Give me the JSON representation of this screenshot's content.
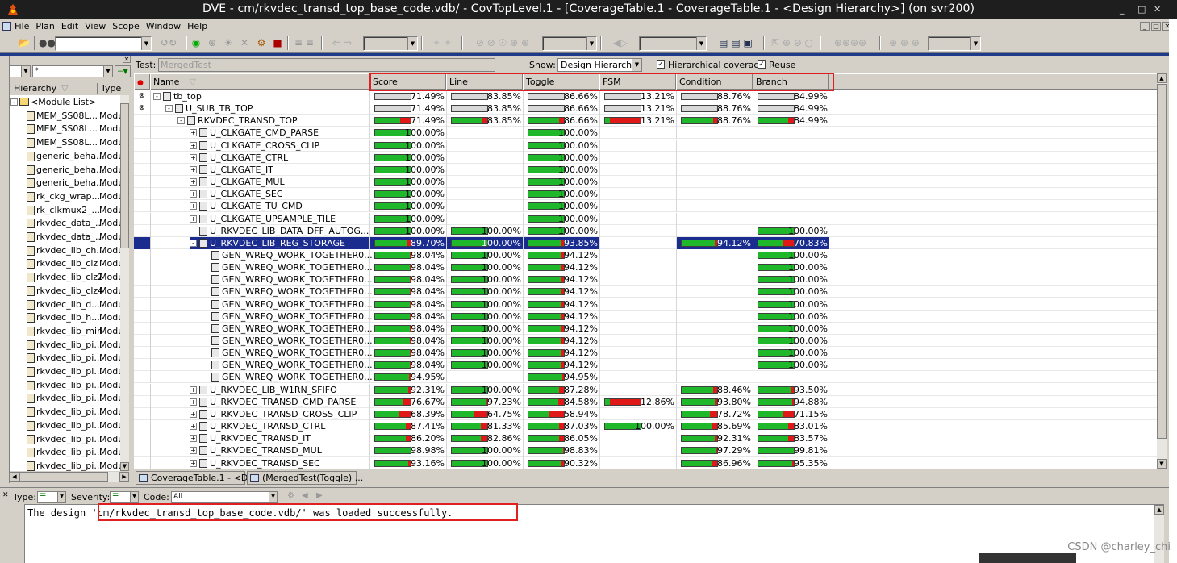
{
  "window": {
    "title": "DVE - cm/rkvdec_transd_top_base_code.vdb/ -  CovTopLevel.1 - [CoverageTable.1 - CoverageTable.1 - <Design Hierarchy>] (on svr200)",
    "min_label": "_",
    "max_label": "□",
    "close_label": "✕"
  },
  "menu": [
    "File",
    "Plan",
    "Edit",
    "View",
    "Scope",
    "Window",
    "Help"
  ],
  "mdi_controls": [
    "_",
    "□",
    "✕"
  ],
  "hierarchy": {
    "filter_value": "*",
    "col_hierarchy": "Hierarchy",
    "col_type": "Type",
    "items": [
      {
        "name": "<Module List>",
        "type": "",
        "folder": true
      },
      {
        "name": "MEM_SS08L...",
        "type": "Modu"
      },
      {
        "name": "MEM_SS08L...",
        "type": "Modu"
      },
      {
        "name": "MEM_SS08L...",
        "type": "Modu"
      },
      {
        "name": "generic_beha...",
        "type": "Modu"
      },
      {
        "name": "generic_beha...",
        "type": "Modu"
      },
      {
        "name": "generic_beha...",
        "type": "Modu"
      },
      {
        "name": "rk_ckg_wrap...",
        "type": "Modu"
      },
      {
        "name": "rk_clkmux2_...",
        "type": "Modu"
      },
      {
        "name": "rkvdec_data_...",
        "type": "Modu"
      },
      {
        "name": "rkvdec_data_...",
        "type": "Modu"
      },
      {
        "name": "rkvdec_lib_ch...",
        "type": "Modu"
      },
      {
        "name": "rkvdec_lib_clz",
        "type": "Modu"
      },
      {
        "name": "rkvdec_lib_clz2",
        "type": "Modu"
      },
      {
        "name": "rkvdec_lib_clz4",
        "type": "Modu"
      },
      {
        "name": "rkvdec_lib_d...",
        "type": "Modu"
      },
      {
        "name": "rkvdec_lib_h...",
        "type": "Modu"
      },
      {
        "name": "rkvdec_lib_min",
        "type": "Modu"
      },
      {
        "name": "rkvdec_lib_pi...",
        "type": "Modu"
      },
      {
        "name": "rkvdec_lib_pi...",
        "type": "Modu"
      },
      {
        "name": "rkvdec_lib_pi...",
        "type": "Modu"
      },
      {
        "name": "rkvdec_lib_pi...",
        "type": "Modu"
      },
      {
        "name": "rkvdec_lib_pi...",
        "type": "Modu"
      },
      {
        "name": "rkvdec_lib_pi...",
        "type": "Modu"
      },
      {
        "name": "rkvdec_lib_pi...",
        "type": "Modu"
      },
      {
        "name": "rkvdec_lib_pi...",
        "type": "Modu"
      },
      {
        "name": "rkvdec_lib_pi...",
        "type": "Modu"
      },
      {
        "name": "rkvdec_lib_pi...",
        "type": "Modu"
      }
    ]
  },
  "coverage": {
    "test_label": "Test:",
    "test_value": "MergedTest",
    "show_label": "Show:",
    "show_value": "Design Hierarchy",
    "hier_cov_label": "Hierarchical coverage",
    "hier_cov_checked": true,
    "reuse_label": "Reuse",
    "reuse_checked": true,
    "columns": [
      "Name",
      "Score",
      "Line",
      "Toggle",
      "FSM",
      "Condition",
      "Branch"
    ],
    "rows": [
      {
        "name": "tb_top",
        "indent": 0,
        "dot": "⊗",
        "expander": "-",
        "score": "71.49%",
        "line": "83.85%",
        "toggle": "86.66%",
        "fsm": "13.21%",
        "cond": "88.76%",
        "branch": "84.99%",
        "grey": true
      },
      {
        "name": "U_SUB_TB_TOP",
        "indent": 1,
        "dot": "⊗",
        "expander": "-",
        "score": "71.49%",
        "line": "83.85%",
        "toggle": "86.66%",
        "fsm": "13.21%",
        "cond": "88.76%",
        "branch": "84.99%",
        "grey": true
      },
      {
        "name": "RKVDEC_TRANSD_TOP",
        "indent": 2,
        "expander": "-",
        "score": "71.49%",
        "line": "83.85%",
        "toggle": "86.66%",
        "fsm": "13.21%",
        "cond": "88.76%",
        "branch": "84.99%"
      },
      {
        "name": "U_CLKGATE_CMD_PARSE",
        "indent": 3,
        "expander": "+",
        "score": "100.00%",
        "toggle": "100.00%"
      },
      {
        "name": "U_CLKGATE_CROSS_CLIP",
        "indent": 3,
        "expander": "+",
        "score": "100.00%",
        "toggle": "100.00%"
      },
      {
        "name": "U_CLKGATE_CTRL",
        "indent": 3,
        "expander": "+",
        "score": "100.00%",
        "toggle": "100.00%"
      },
      {
        "name": "U_CLKGATE_IT",
        "indent": 3,
        "expander": "+",
        "score": "100.00%",
        "toggle": "100.00%"
      },
      {
        "name": "U_CLKGATE_MUL",
        "indent": 3,
        "expander": "+",
        "score": "100.00%",
        "toggle": "100.00%"
      },
      {
        "name": "U_CLKGATE_SEC",
        "indent": 3,
        "expander": "+",
        "score": "100.00%",
        "toggle": "100.00%"
      },
      {
        "name": "U_CLKGATE_TU_CMD",
        "indent": 3,
        "expander": "+",
        "score": "100.00%",
        "toggle": "100.00%"
      },
      {
        "name": "U_CLKGATE_UPSAMPLE_TILE",
        "indent": 3,
        "expander": "+",
        "score": "100.00%",
        "toggle": "100.00%"
      },
      {
        "name": "U_RKVDEC_LIB_DATA_DFF_AUTOG...",
        "indent": 3,
        "expander": "",
        "score": "100.00%",
        "line": "100.00%",
        "toggle": "100.00%",
        "branch": "100.00%"
      },
      {
        "name": "U_RKVDEC_LIB_REG_STORAGE",
        "indent": 3,
        "expander": "-",
        "score": "89.70%",
        "line": "100.00%",
        "toggle": "93.85%",
        "cond": "94.12%",
        "branch": "70.83%",
        "selected": true
      },
      {
        "name": "GEN_WREQ_WORK_TOGETHER0...",
        "indent": 4,
        "score": "98.04%",
        "line": "100.00%",
        "toggle": "94.12%",
        "branch": "100.00%"
      },
      {
        "name": "GEN_WREQ_WORK_TOGETHER0...",
        "indent": 4,
        "score": "98.04%",
        "line": "100.00%",
        "toggle": "94.12%",
        "branch": "100.00%"
      },
      {
        "name": "GEN_WREQ_WORK_TOGETHER0...",
        "indent": 4,
        "score": "98.04%",
        "line": "100.00%",
        "toggle": "94.12%",
        "branch": "100.00%"
      },
      {
        "name": "GEN_WREQ_WORK_TOGETHER0...",
        "indent": 4,
        "score": "98.04%",
        "line": "100.00%",
        "toggle": "94.12%",
        "branch": "100.00%"
      },
      {
        "name": "GEN_WREQ_WORK_TOGETHER0...",
        "indent": 4,
        "score": "98.04%",
        "line": "100.00%",
        "toggle": "94.12%",
        "branch": "100.00%"
      },
      {
        "name": "GEN_WREQ_WORK_TOGETHER0...",
        "indent": 4,
        "score": "98.04%",
        "line": "100.00%",
        "toggle": "94.12%",
        "branch": "100.00%"
      },
      {
        "name": "GEN_WREQ_WORK_TOGETHER0...",
        "indent": 4,
        "score": "98.04%",
        "line": "100.00%",
        "toggle": "94.12%",
        "branch": "100.00%"
      },
      {
        "name": "GEN_WREQ_WORK_TOGETHER0...",
        "indent": 4,
        "score": "98.04%",
        "line": "100.00%",
        "toggle": "94.12%",
        "branch": "100.00%"
      },
      {
        "name": "GEN_WREQ_WORK_TOGETHER0...",
        "indent": 4,
        "score": "98.04%",
        "line": "100.00%",
        "toggle": "94.12%",
        "branch": "100.00%"
      },
      {
        "name": "GEN_WREQ_WORK_TOGETHER0...",
        "indent": 4,
        "score": "98.04%",
        "line": "100.00%",
        "toggle": "94.12%",
        "branch": "100.00%"
      },
      {
        "name": "GEN_WREQ_WORK_TOGETHER0...",
        "indent": 4,
        "score": "94.95%",
        "toggle": "94.95%"
      },
      {
        "name": "U_RKVDEC_LIB_W1RN_SFIFO",
        "indent": 3,
        "expander": "+",
        "score": "92.31%",
        "line": "100.00%",
        "toggle": "87.28%",
        "cond": "88.46%",
        "branch": "93.50%"
      },
      {
        "name": "U_RKVDEC_TRANSD_CMD_PARSE",
        "indent": 3,
        "expander": "+",
        "score": "76.67%",
        "line": "97.23%",
        "toggle": "84.58%",
        "fsm": "12.86%",
        "cond": "93.80%",
        "branch": "94.88%"
      },
      {
        "name": "U_RKVDEC_TRANSD_CROSS_CLIP",
        "indent": 3,
        "expander": "+",
        "score": "68.39%",
        "line": "64.75%",
        "toggle": "58.94%",
        "cond": "78.72%",
        "branch": "71.15%"
      },
      {
        "name": "U_RKVDEC_TRANSD_CTRL",
        "indent": 3,
        "expander": "+",
        "score": "87.41%",
        "line": "81.33%",
        "toggle": "87.03%",
        "fsm": "100.00%",
        "cond": "85.69%",
        "branch": "83.01%"
      },
      {
        "name": "U_RKVDEC_TRANSD_IT",
        "indent": 3,
        "expander": "+",
        "score": "86.20%",
        "line": "82.86%",
        "toggle": "86.05%",
        "cond": "92.31%",
        "branch": "83.57%"
      },
      {
        "name": "U_RKVDEC_TRANSD_MUL",
        "indent": 3,
        "expander": "+",
        "score": "98.98%",
        "line": "100.00%",
        "toggle": "98.83%",
        "cond": "97.29%",
        "branch": "99.81%"
      },
      {
        "name": "U_RKVDEC_TRANSD_SEC",
        "indent": 3,
        "expander": "+",
        "score": "93.16%",
        "line": "100.00%",
        "toggle": "90.32%",
        "cond": "86.96%",
        "branch": "95.35%"
      }
    ]
  },
  "tabs": [
    "CoverageTable.1 - <D...",
    "(MergedTest(Toggle) ..."
  ],
  "console": {
    "type_label": "Type:",
    "severity_label": "Severity:",
    "code_label": "Code:",
    "code_value": "All",
    "message": "The design 'cm/rkvdec_transd_top_base_code.vdb/' was loaded successfully."
  },
  "watermark": "CSDN @charley_chi",
  "colors": {
    "covered": "#1fb82a",
    "uncovered": "#e01818",
    "selection": "#1a2d8f",
    "highlight_box": "#e02020"
  }
}
